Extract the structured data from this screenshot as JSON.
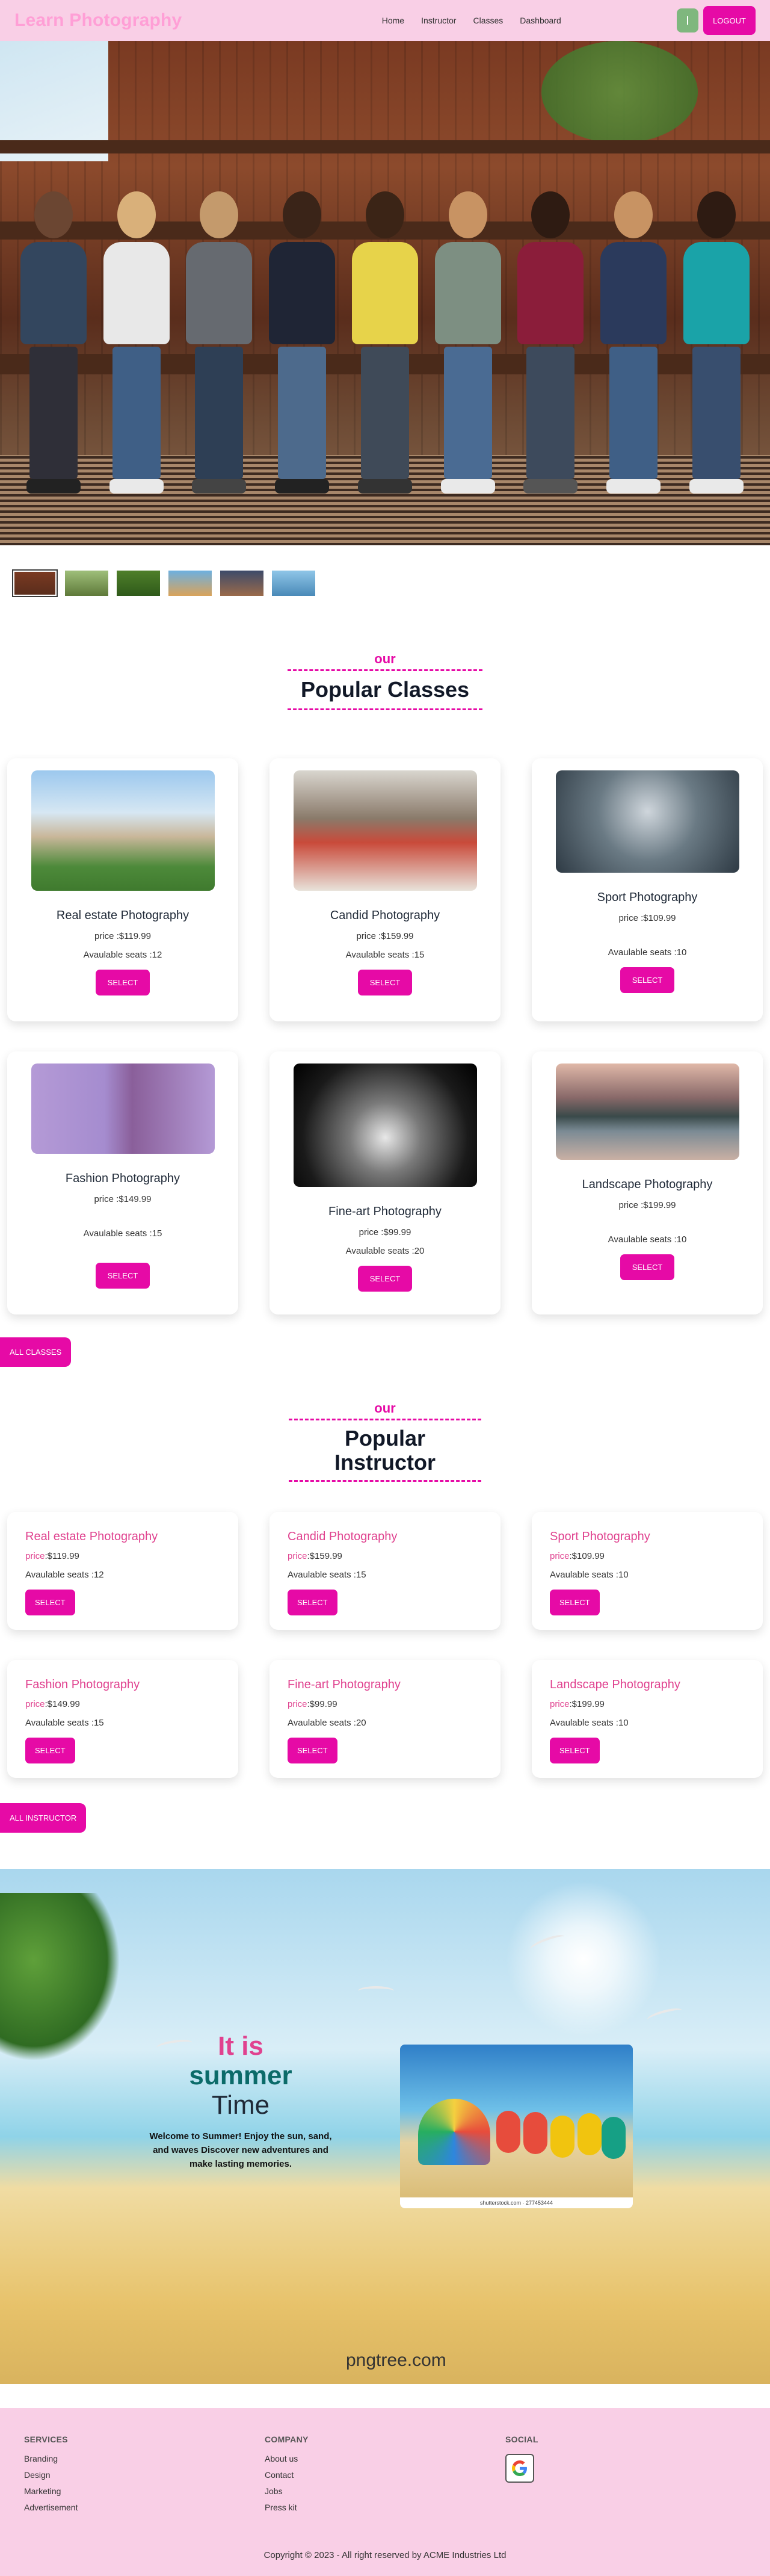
{
  "nav": {
    "logo": "Learn Photography",
    "links": [
      "Home",
      "Instructor",
      "Classes",
      "Dashboard"
    ],
    "avatar_initial": "",
    "logout": "LOGOUT"
  },
  "hero": {
    "thumbs_count": 6
  },
  "classes_section": {
    "our": "our",
    "title": "Popular Classes",
    "select_label": "SELECT",
    "all_button": "ALL CLASSES",
    "cards": [
      {
        "title": "Real estate Photography",
        "price": "price :$119.99",
        "seats": "Avaulable seats :12"
      },
      {
        "title": "Candid Photography",
        "price": "price :$159.99",
        "seats": "Avaulable seats :15"
      },
      {
        "title": "Sport Photography",
        "price": "price :$109.99",
        "seats": "Avaulable seats :10"
      },
      {
        "title": "Fashion Photography",
        "price": "price :$149.99",
        "seats": "Avaulable seats :15"
      },
      {
        "title": "Fine-art Photography",
        "price": "price :$99.99",
        "seats": "Avaulable seats :20"
      },
      {
        "title": "Landscape Photography",
        "price": "price :$199.99",
        "seats": "Avaulable seats :10"
      }
    ]
  },
  "instructor_section": {
    "our": "our",
    "title": "Popular Instructor",
    "price_label": "price",
    "select_label": "SELECT",
    "all_button": "ALL INSTRUCTOR",
    "cards": [
      {
        "title": "Real estate Photography",
        "price": ":$119.99",
        "seats": "Avaulable seats :12"
      },
      {
        "title": "Candid Photography",
        "price": ":$159.99",
        "seats": "Avaulable seats :15"
      },
      {
        "title": "Sport Photography",
        "price": ":$109.99",
        "seats": "Avaulable seats :10"
      },
      {
        "title": "Fashion Photography",
        "price": ":$149.99",
        "seats": "Avaulable seats :15"
      },
      {
        "title": "Fine-art Photography",
        "price": ":$99.99",
        "seats": "Avaulable seats :20"
      },
      {
        "title": "Landscape Photography",
        "price": ":$199.99",
        "seats": "Avaulable seats :10"
      }
    ]
  },
  "summer": {
    "line1": "It is",
    "line2": "summer",
    "line3": "Time",
    "desc": "Welcome to Summer! Enjoy the sun, sand, and waves Discover new adventures and make lasting memories.",
    "image_caption": "shutterstock.com · 277453444",
    "watermark": "pngtree.com"
  },
  "footer": {
    "services_title": "SERVICES",
    "services": [
      "Branding",
      "Design",
      "Marketing",
      "Advertisement"
    ],
    "company_title": "COMPANY",
    "company": [
      "About us",
      "Contact",
      "Jobs",
      "Press kit"
    ],
    "social_title": "SOCIAL",
    "copyright": "Copyright © 2023 - All right reserved by ACME Industries Ltd"
  },
  "colors": {
    "accent": "#e60aa6",
    "nav_bg": "#f9cfe6",
    "instructor_title": "#e0428f",
    "summer_teal": "#0b6b69"
  }
}
